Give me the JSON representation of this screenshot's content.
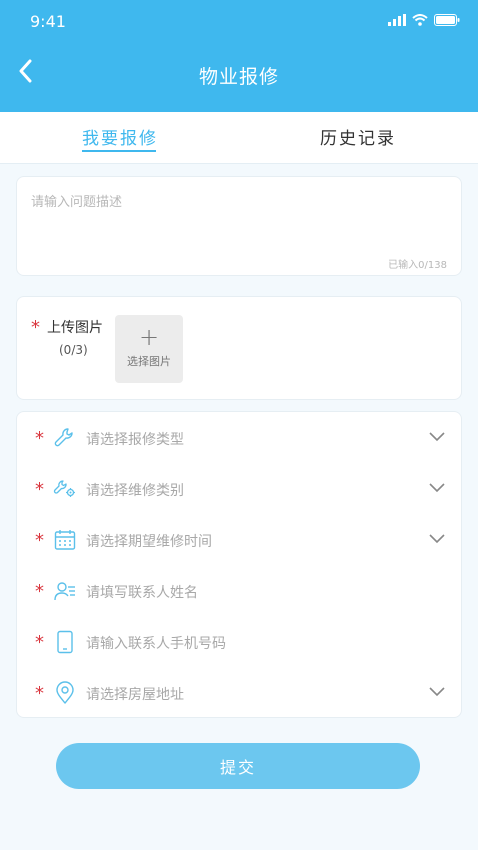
{
  "status_bar": {
    "time": "9:41"
  },
  "header": {
    "title": "物业报修"
  },
  "tabs": [
    {
      "label": "我要报修",
      "active": true
    },
    {
      "label": "历史记录",
      "active": false
    }
  ],
  "description": {
    "placeholder": "请输入问题描述",
    "counter": "已输入0/138"
  },
  "upload": {
    "required_mark": "*",
    "label": "上传图片",
    "count": "(0/3)",
    "plus": "+",
    "button_label": "选择图片"
  },
  "form_rows": [
    {
      "required_mark": "*",
      "icon": "wrench-icon",
      "placeholder": "请选择报修类型",
      "has_chevron": true
    },
    {
      "required_mark": "*",
      "icon": "wrench-gear-icon",
      "placeholder": "请选择维修类别",
      "has_chevron": true
    },
    {
      "required_mark": "*",
      "icon": "calendar-icon",
      "placeholder": "请选择期望维修时间",
      "has_chevron": true
    },
    {
      "required_mark": "*",
      "icon": "contact-person-icon",
      "placeholder": "请填写联系人姓名",
      "has_chevron": false
    },
    {
      "required_mark": "*",
      "icon": "phone-icon",
      "placeholder": "请输入联系人手机号码",
      "has_chevron": false
    },
    {
      "required_mark": "*",
      "icon": "location-pin-icon",
      "placeholder": "请选择房屋地址",
      "has_chevron": true
    }
  ],
  "submit": {
    "label": "提交"
  },
  "colors": {
    "primary": "#3fb8ee",
    "button": "#6cc7ef",
    "required": "#d9363e",
    "icon": "#5bc0ea"
  }
}
